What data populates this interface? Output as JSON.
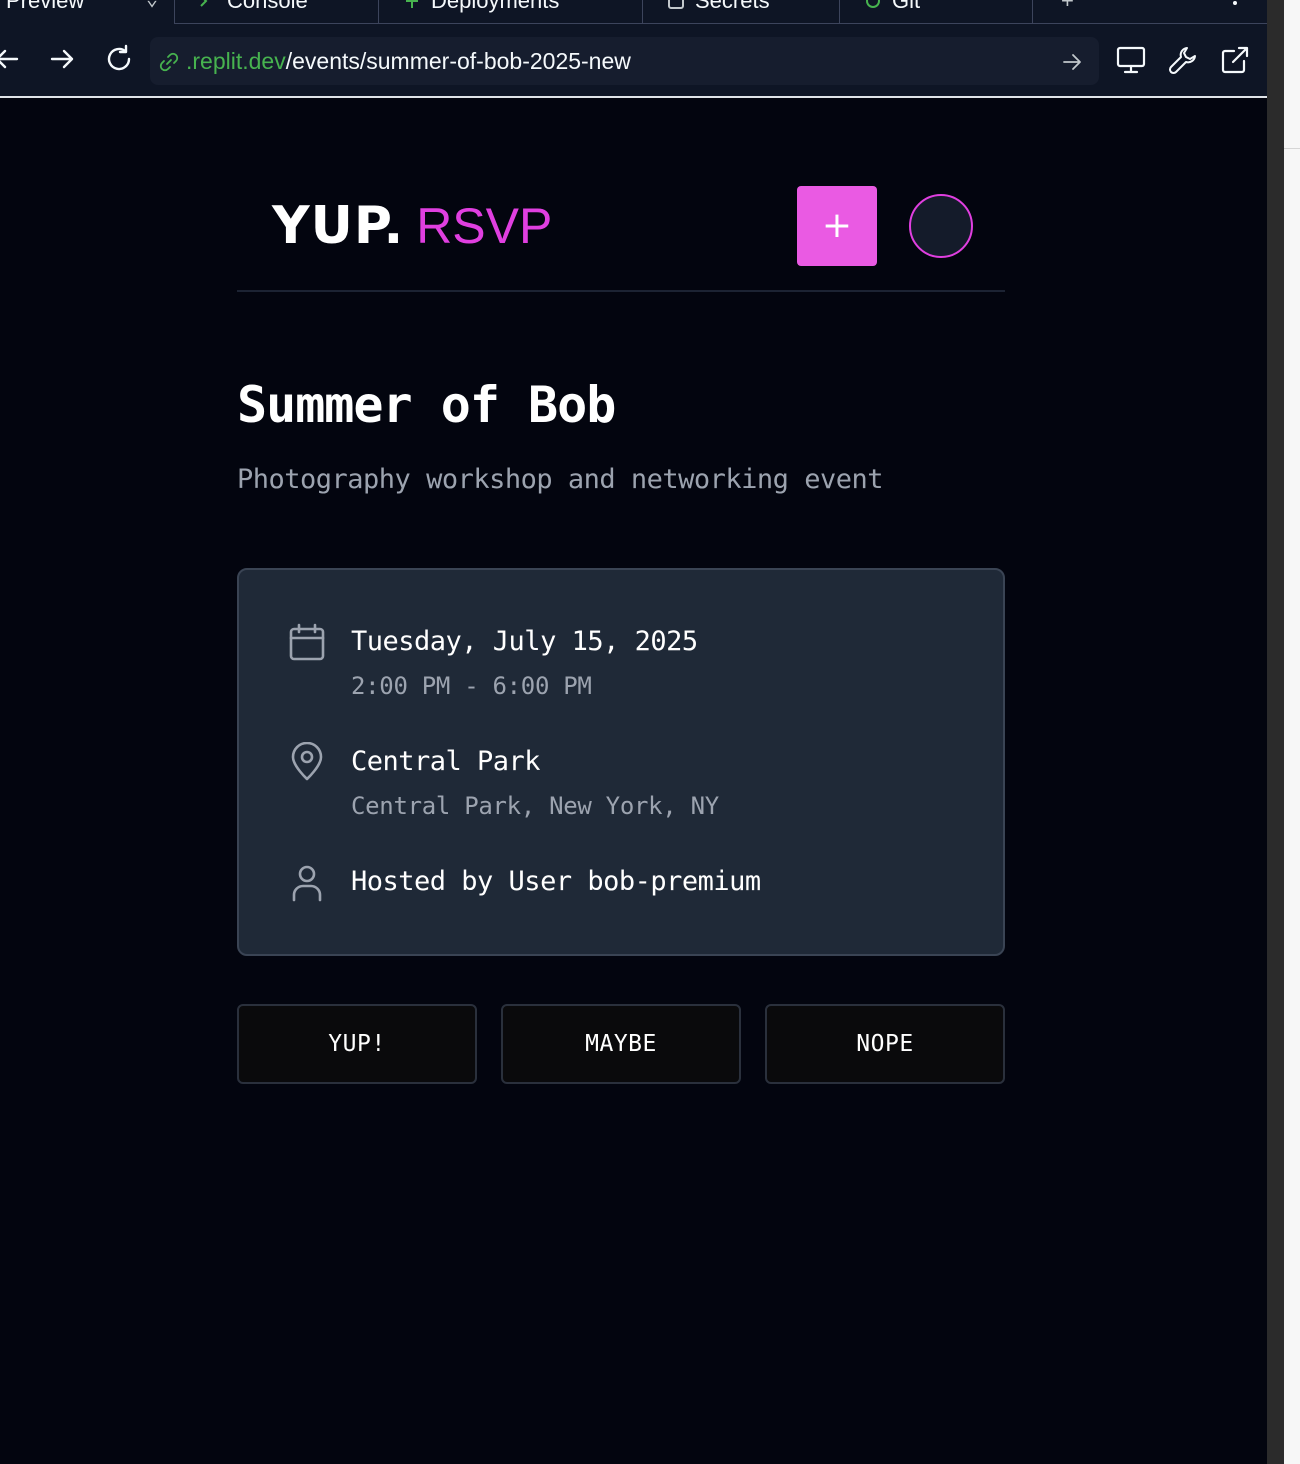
{
  "browser": {
    "tabs": [
      {
        "label": "Preview"
      },
      {
        "label": "Console"
      },
      {
        "label": "Deployments"
      },
      {
        "label": "Secrets"
      },
      {
        "label": "Git"
      }
    ],
    "new_tab_label": "+",
    "url_domain": ".replit.dev",
    "url_path": "/events/summer-of-bob-2025-new"
  },
  "app": {
    "logo_main": "YUP.",
    "logo_accent": "RSVP",
    "add_label": "+",
    "accent_color": "#e03fe0",
    "event": {
      "title": "Summer of Bob",
      "subtitle": "Photography workshop and networking event",
      "date": "Tuesday, July 15, 2025",
      "time": "2:00 PM - 6:00 PM",
      "venue": "Central Park",
      "address": "Central Park, New York, NY",
      "host": "Hosted by User bob-premium"
    },
    "rsvp_options": [
      "YUP!",
      "MAYBE",
      "NOPE"
    ]
  }
}
